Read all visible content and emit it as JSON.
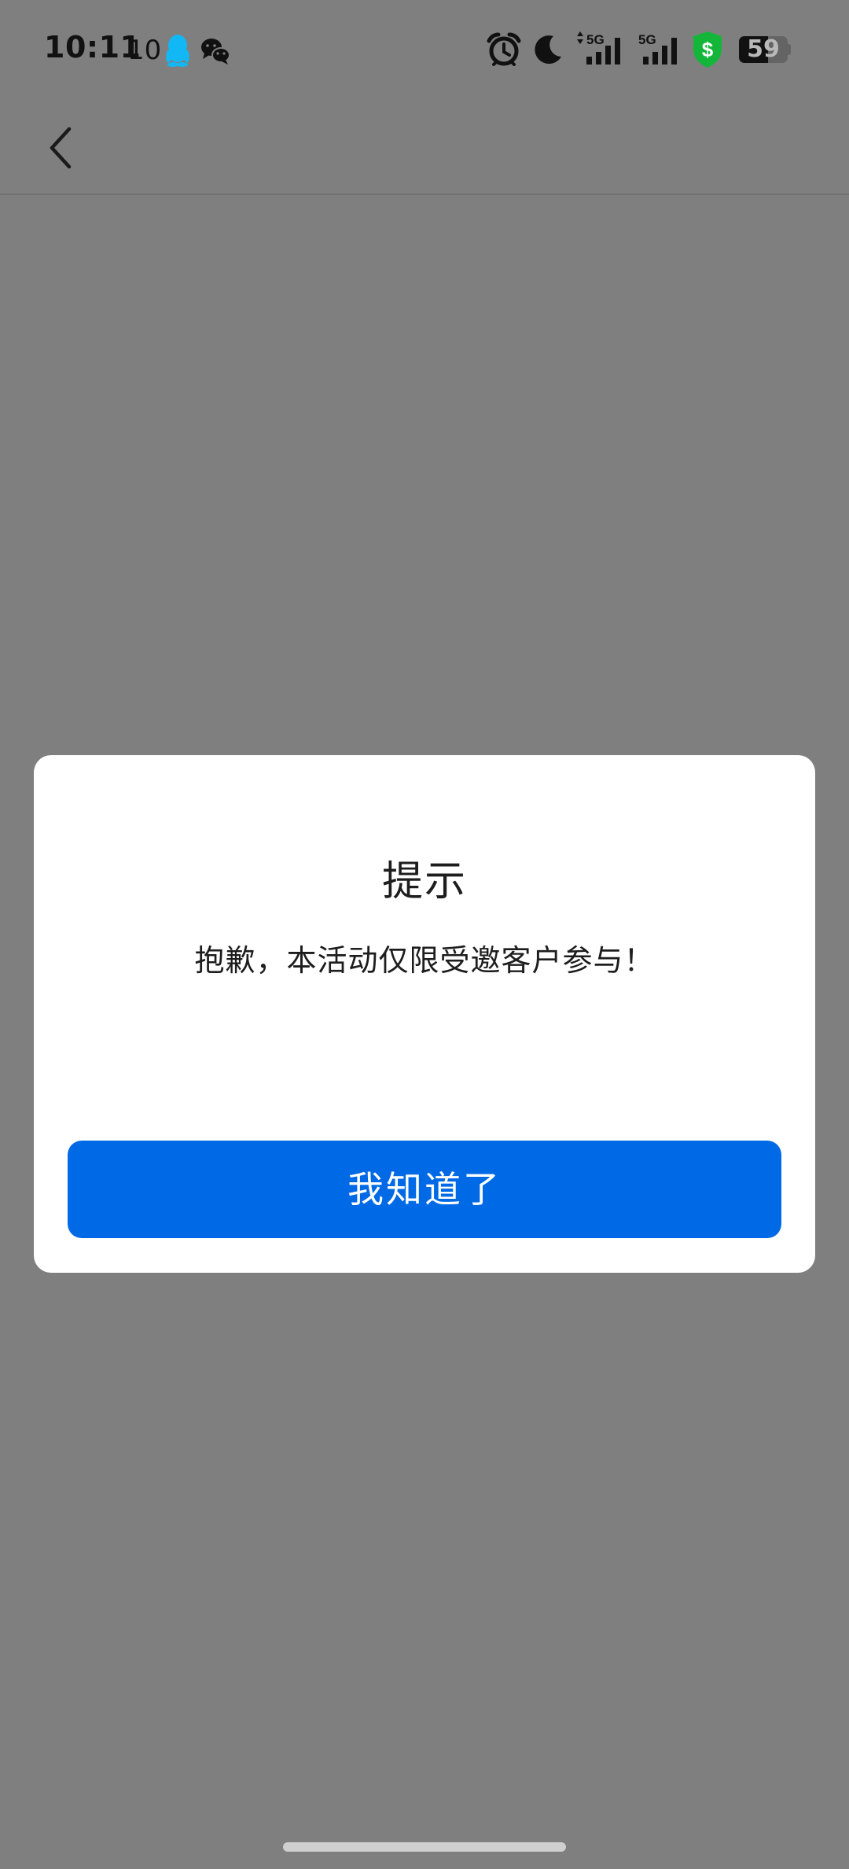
{
  "status_bar": {
    "time": "10:11",
    "notification_count": "10",
    "battery_level": "59",
    "battery_fraction": 0.59,
    "icons": [
      "qq-icon",
      "wechat-icon",
      "alarm-icon",
      "moon-icon",
      "signal-5g-icon",
      "signal-5g-icon",
      "shield-dollar-icon",
      "battery-icon"
    ],
    "signal_label_1": "5G",
    "signal_label_2": "5G",
    "colors": {
      "qq": "#11b8f5",
      "shield": "#14b63a"
    }
  },
  "nav": {
    "back_icon": "chevron-left-icon"
  },
  "dialog": {
    "title": "提示",
    "message": "抱歉，本活动仅限受邀客户参与！",
    "confirm_label": "我知道了"
  },
  "colors": {
    "overlay": "#7f7f7f",
    "accent": "#006ae6",
    "dialog_bg": "#ffffff"
  }
}
